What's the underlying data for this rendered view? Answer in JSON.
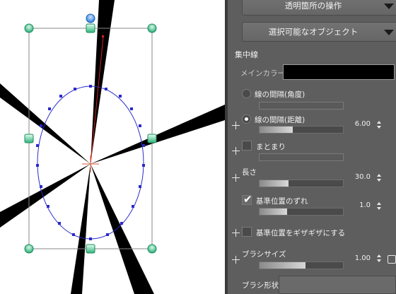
{
  "panel": {
    "transparent_ops_label": "透明箇所の操作",
    "selectable_objects_label": "選択可能なオブジェクト",
    "section_title": "集中線",
    "main_color_label": "メインカラー",
    "main_color": "#000000",
    "spacing_angle_label": "線の間隔(角度)",
    "spacing_distance_label": "線の間隔(距離)",
    "spacing_distance_value": "6.00",
    "spacing_distance_level": 0.4,
    "cluster_label": "まとまり",
    "length_label": "長さ",
    "length_value": "30.0",
    "length_level": 0.35,
    "offset_label": "基準位置のずれ",
    "offset_value": "1.0",
    "offset_level": 0.33,
    "jagged_label": "基準位置をギザギザにする",
    "brush_size_label": "ブラシサイズ",
    "brush_size_value": "1.00",
    "brush_size_level": 0.55,
    "brush_shape_label": "ブラシ形状"
  },
  "canvas": {
    "guide_color": "#2a2acc",
    "handle_color": "#2fb37a",
    "bbox_color": "#888888"
  }
}
